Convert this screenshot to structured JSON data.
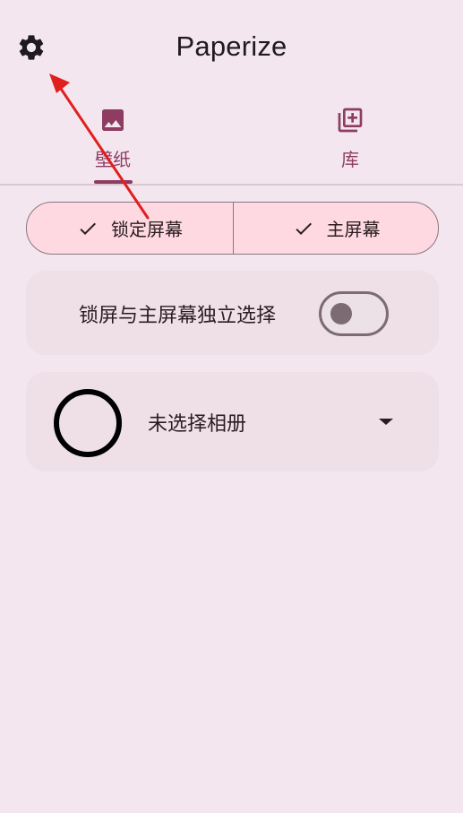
{
  "header": {
    "title": "Paperize",
    "settings_icon": "gear-icon"
  },
  "tabs": [
    {
      "label": "壁纸",
      "icon": "image-icon",
      "selected": true
    },
    {
      "label": "库",
      "icon": "library-add-icon",
      "selected": false
    }
  ],
  "segmented": [
    {
      "label": "锁定屏幕",
      "checked": true
    },
    {
      "label": "主屏幕",
      "checked": true
    }
  ],
  "independent_toggle": {
    "label": "锁屏与主屏幕独立选择",
    "on": false
  },
  "album_selector": {
    "label": "未选择相册",
    "icon": "chevron-down-icon"
  },
  "colors": {
    "accent": "#8e3c62",
    "background": "#f4e6ee",
    "annotation": "#e0201e"
  }
}
